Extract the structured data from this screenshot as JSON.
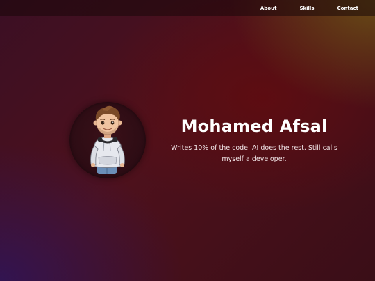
{
  "nav": {
    "links": [
      {
        "label": "About"
      },
      {
        "label": "Skills"
      },
      {
        "label": "Contact"
      }
    ]
  },
  "hero": {
    "name": "Mohamed Afsal",
    "tagline": "Writes 10% of the code. AI does the rest. Still calls myself a developer.",
    "avatar": "cartoon-developer-avatar"
  },
  "colors": {
    "background_dark": "#3b0f24",
    "background_red": "#5f0c10",
    "background_purple": "#2d145a",
    "background_gold": "#6e5514",
    "text": "#ffffff"
  }
}
